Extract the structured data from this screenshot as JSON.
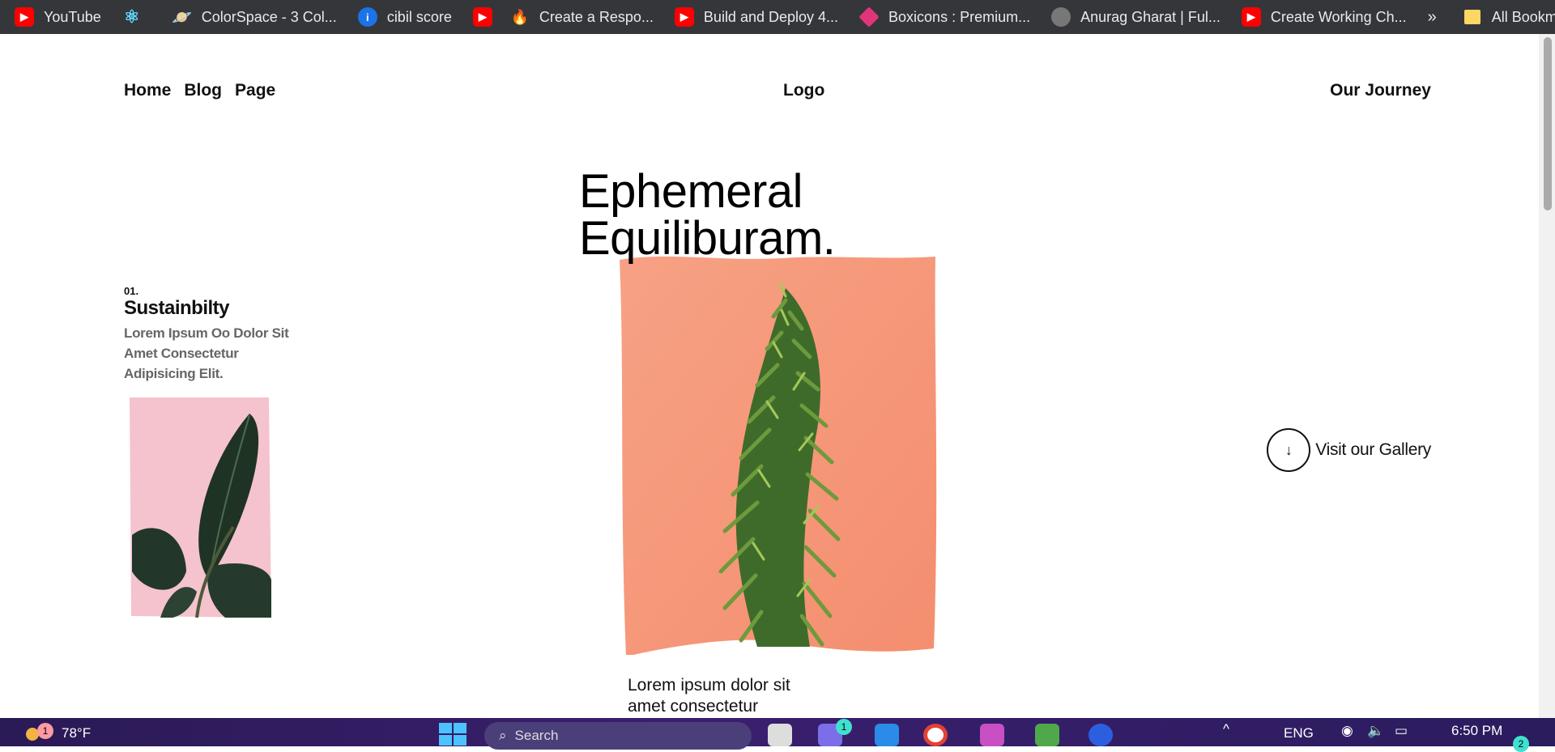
{
  "bookmarks": [
    {
      "label": "YouTube",
      "icon": "youtube-icon"
    },
    {
      "label": "",
      "icon": "react-icon"
    },
    {
      "label": "ColorSpace - 3 Col...",
      "icon": "planet-icon"
    },
    {
      "label": "cibil score",
      "icon": "cibil-icon"
    },
    {
      "label": "",
      "icon": "youtube-icon"
    },
    {
      "label": "Create a Respo...",
      "icon": "fire-icon"
    },
    {
      "label": "Build and Deploy 4...",
      "icon": "youtube-icon"
    },
    {
      "label": "Boxicons : Premium...",
      "icon": "boxicons-icon"
    },
    {
      "label": "Anurag Gharat | Ful...",
      "icon": "globe-icon"
    },
    {
      "label": "Create Working Ch...",
      "icon": "youtube-icon"
    }
  ],
  "bookmarks_more": "»",
  "all_bookmarks": "All Bookmarks",
  "nav": {
    "links": [
      "Home",
      "Blog",
      "Page"
    ],
    "logo": "Logo",
    "right": "Our Journey"
  },
  "hero": {
    "title_line1": "Ephemeral",
    "title_line2": "Equiliburam."
  },
  "feature": {
    "number": "01.",
    "title": "Sustainbilty",
    "text": "Lorem Ipsum Oo Dolor Sit Amet Consectetur Adipisicing Elit."
  },
  "gallery": {
    "label": "Visit our Gallery",
    "icon": "arrow-down-icon"
  },
  "bottom_text": "Lorem ipsum dolor sit amet consectetur",
  "taskbar": {
    "weather_badge": "1",
    "weather": "78°F",
    "search_placeholder": "Search",
    "teams_badge": "1",
    "language": "ENG",
    "time": "6:50 PM",
    "notif_badge": "2"
  },
  "colors": {
    "hero_bg": "#f69a7a",
    "small_bg": "#f5c5cf",
    "taskbar": "#2a1a55"
  }
}
